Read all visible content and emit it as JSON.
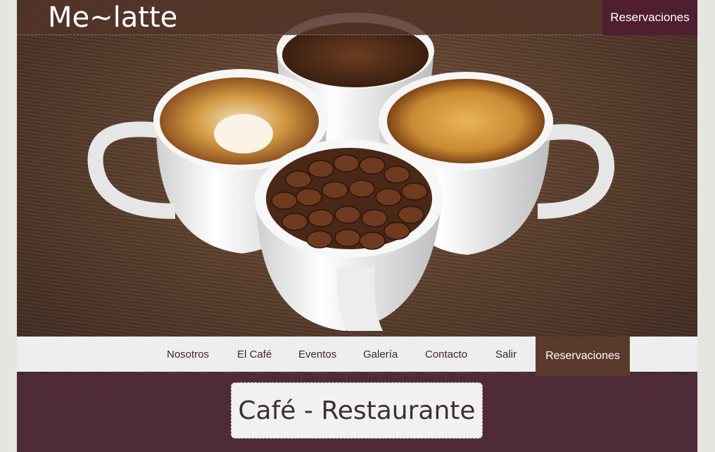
{
  "header": {
    "logo": "Me~latte",
    "reservations_top": "Reservaciones"
  },
  "nav": {
    "items": [
      {
        "label": "Nosotros"
      },
      {
        "label": "El Café"
      },
      {
        "label": "Eventos"
      },
      {
        "label": "Galería"
      },
      {
        "label": "Contacto"
      },
      {
        "label": "Salir"
      }
    ],
    "reservations": "Reservaciones"
  },
  "main": {
    "title": "Café - Restaurante"
  },
  "colors": {
    "plum": "#4f2a39",
    "dark_plum_button": "#4f1f30",
    "brown_button": "#5b3a2e",
    "nav_bg": "#eeeeee"
  }
}
